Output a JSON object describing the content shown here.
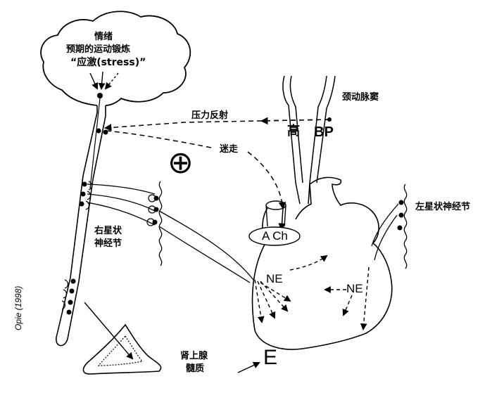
{
  "brain": {
    "line1": "情绪",
    "line2": "预期的运动锻炼",
    "line3": "“应激(stress)”"
  },
  "labels": {
    "carotid_sinus": "颈动脉窦",
    "baroreflex": "压力反射",
    "high": "高",
    "bp": "BP",
    "vagus": "迷走",
    "plus_symbol": "⊕",
    "right_ganglion_line1": "右星状",
    "right_ganglion_line2": "神经节",
    "left_ganglion": "左星状神经节",
    "ach": "A Ch",
    "ne_left": "NE",
    "ne_right": "NE",
    "adrenal_line1": "肾上腺",
    "adrenal_line2": "髓质",
    "epinephrine": "E",
    "citation": "Opie (1998)"
  }
}
